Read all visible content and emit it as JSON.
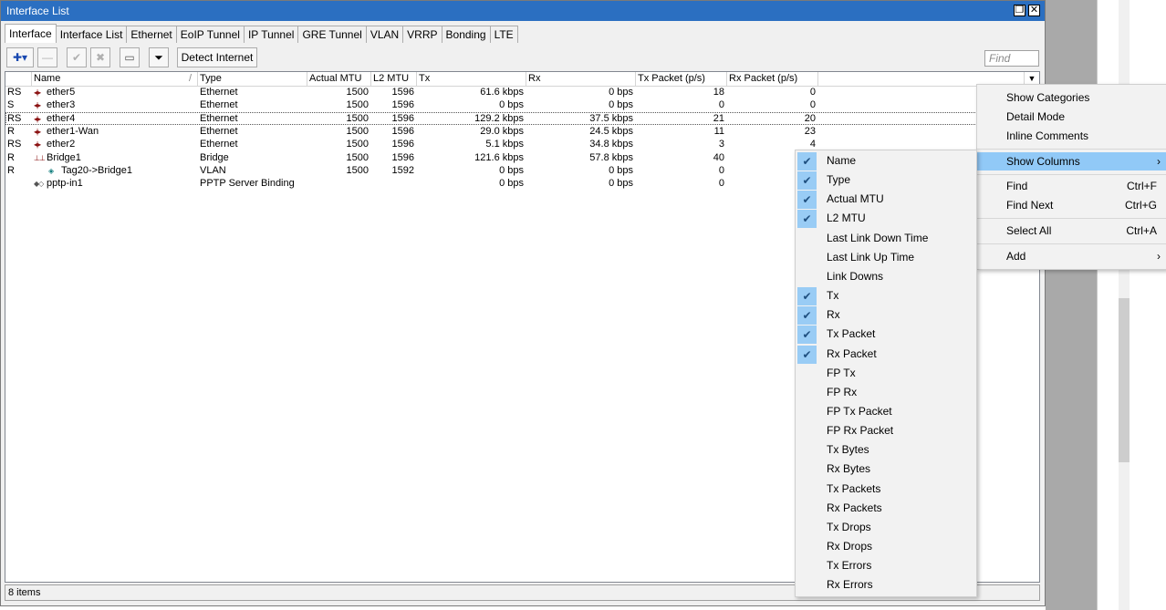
{
  "window": {
    "title": "Interface List",
    "restore_glyph": "❐",
    "close_glyph": "✕"
  },
  "tabs": [
    "Interface",
    "Interface List",
    "Ethernet",
    "EoIP Tunnel",
    "IP Tunnel",
    "GRE Tunnel",
    "VLAN",
    "VRRP",
    "Bonding",
    "LTE"
  ],
  "toolbar": {
    "add_glyph": "✚▾",
    "remove_glyph": "—",
    "enable_glyph": "✔",
    "disable_glyph": "✖",
    "comment_glyph": "▭",
    "filter_glyph": "⏷",
    "detect_label": "Detect Internet",
    "find_placeholder": "Find"
  },
  "columns": [
    "Name",
    "Type",
    "Actual MTU",
    "L2 MTU",
    "Tx",
    "Rx",
    "Tx Packet (p/s)",
    "Rx Packet (p/s)"
  ],
  "sort_glyph": "/",
  "dropdown_glyph": "▼",
  "rows": [
    {
      "flag": "RS",
      "icon": "◂|▸",
      "name": "ether5",
      "type": "Ethernet",
      "mtu": "1500",
      "l2mtu": "1596",
      "tx": "61.6 kbps",
      "rx": "0 bps",
      "txp": "18",
      "rxp": "0"
    },
    {
      "flag": "S",
      "icon": "◂|▸",
      "name": "ether3",
      "type": "Ethernet",
      "mtu": "1500",
      "l2mtu": "1596",
      "tx": "0 bps",
      "rx": "0 bps",
      "txp": "0",
      "rxp": "0"
    },
    {
      "flag": "RS",
      "icon": "◂|▸",
      "name": "ether4",
      "type": "Ethernet",
      "mtu": "1500",
      "l2mtu": "1596",
      "tx": "129.2 kbps",
      "rx": "37.5 kbps",
      "txp": "21",
      "rxp": "20"
    },
    {
      "flag": "R",
      "icon": "◂|▸",
      "name": "ether1-Wan",
      "type": "Ethernet",
      "mtu": "1500",
      "l2mtu": "1596",
      "tx": "29.0 kbps",
      "rx": "24.5 kbps",
      "txp": "11",
      "rxp": "23"
    },
    {
      "flag": "RS",
      "icon": "◂|▸",
      "name": "ether2",
      "type": "Ethernet",
      "mtu": "1500",
      "l2mtu": "1596",
      "tx": "5.1 kbps",
      "rx": "34.8 kbps",
      "txp": "3",
      "rxp": "4"
    },
    {
      "flag": "R",
      "icon": "⊥⊥",
      "name": "Bridge1",
      "type": "Bridge",
      "mtu": "1500",
      "l2mtu": "1596",
      "tx": "121.6 kbps",
      "rx": "57.8 kbps",
      "txp": "40",
      "rxp": ""
    },
    {
      "flag": "R",
      "icon": "◈",
      "name": "Tag20->Bridge1",
      "type": "VLAN",
      "mtu": "1500",
      "l2mtu": "1592",
      "tx": "0 bps",
      "rx": "0 bps",
      "txp": "0",
      "rxp": ""
    },
    {
      "flag": "",
      "icon": "◆◇",
      "name": "pptp-in1",
      "type": "PPTP Server Binding",
      "mtu": "",
      "l2mtu": "",
      "tx": "0 bps",
      "rx": "0 bps",
      "txp": "0",
      "rxp": ""
    }
  ],
  "status": "8 items",
  "context_menu": [
    {
      "label": "Show Categories",
      "shortcut": ""
    },
    {
      "label": "Detail Mode",
      "shortcut": ""
    },
    {
      "label": "Inline Comments",
      "shortcut": ""
    },
    {
      "label": "Show Columns",
      "shortcut": "",
      "submenu": true
    },
    {
      "label": "Find",
      "shortcut": "Ctrl+F"
    },
    {
      "label": "Find Next",
      "shortcut": "Ctrl+G"
    },
    {
      "label": "Select All",
      "shortcut": "Ctrl+A"
    },
    {
      "label": "Add",
      "shortcut": "",
      "submenu": true
    }
  ],
  "submenu_arrow": "›",
  "check_glyph": "✔",
  "columns_menu": [
    {
      "label": "Name",
      "checked": true
    },
    {
      "label": "Type",
      "checked": true
    },
    {
      "label": "Actual MTU",
      "checked": true
    },
    {
      "label": "L2 MTU",
      "checked": true
    },
    {
      "label": "Last Link Down Time",
      "checked": false
    },
    {
      "label": "Last Link Up Time",
      "checked": false
    },
    {
      "label": "Link Downs",
      "checked": false
    },
    {
      "label": "Tx",
      "checked": true
    },
    {
      "label": "Rx",
      "checked": true
    },
    {
      "label": "Tx Packet",
      "checked": true
    },
    {
      "label": "Rx Packet",
      "checked": true
    },
    {
      "label": "FP Tx",
      "checked": false
    },
    {
      "label": "FP Rx",
      "checked": false
    },
    {
      "label": "FP Tx Packet",
      "checked": false
    },
    {
      "label": "FP Rx Packet",
      "checked": false
    },
    {
      "label": "Tx Bytes",
      "checked": false
    },
    {
      "label": "Rx Bytes",
      "checked": false
    },
    {
      "label": "Tx Packets",
      "checked": false
    },
    {
      "label": "Rx Packets",
      "checked": false
    },
    {
      "label": "Tx Drops",
      "checked": false
    },
    {
      "label": "Rx Drops",
      "checked": false
    },
    {
      "label": "Tx Errors",
      "checked": false
    },
    {
      "label": "Rx Errors",
      "checked": false
    }
  ]
}
